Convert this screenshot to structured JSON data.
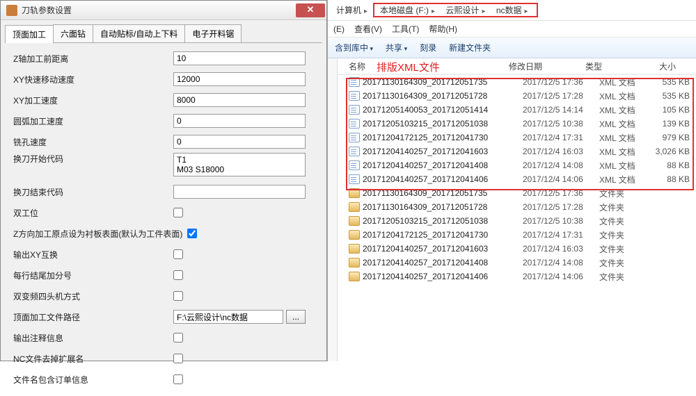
{
  "dialog": {
    "title": "刀轨参数设置",
    "close": "✕",
    "tabs": [
      "顶面加工",
      "六面钻",
      "自动贴标/自动上下料",
      "电子开料锯"
    ],
    "activeTab": 0,
    "fields": {
      "z_before": {
        "label": "Z轴加工前距离",
        "value": "10"
      },
      "xy_rapid": {
        "label": "XY快速移动速度",
        "value": "12000"
      },
      "xy_feed": {
        "label": "XY加工速度",
        "value": "8000"
      },
      "arc_feed": {
        "label": "圆弧加工速度",
        "value": "0"
      },
      "bore_feed": {
        "label": "铣孔速度",
        "value": "0"
      },
      "tool_start": {
        "label": "换刀开始代码",
        "value": "T1\nM03 S18000"
      },
      "tool_end": {
        "label": "换刀结束代码",
        "value": ""
      },
      "dual_station": {
        "label": "双工位",
        "checked": false
      },
      "z_origin_board": {
        "label": "Z方向加工原点设为衬板表面(默认为工件表面)",
        "checked": true
      },
      "out_xy_swap": {
        "label": "输出XY互换",
        "checked": false
      },
      "semi_each": {
        "label": "每行结尾加分号",
        "checked": false
      },
      "dual_freq": {
        "label": "双变频四头机方式",
        "checked": false
      },
      "top_path": {
        "label": "顶面加工文件路径",
        "value": "F:\\云熙设计\\nc数据",
        "browse": "..."
      },
      "out_note": {
        "label": "输出注释信息",
        "checked": false
      },
      "nc_noext": {
        "label": "NC文件去掉扩展名",
        "checked": false
      },
      "fname_order": {
        "label": "文件名包含订单信息",
        "checked": false
      }
    }
  },
  "explorer": {
    "breadcrumb": [
      "计算机",
      "本地磁盘 (F:)",
      "云熙设计",
      "nc数据"
    ],
    "menubar": [
      "(E)",
      "查看(V)",
      "工具(T)",
      "帮助(H)"
    ],
    "toolbar": {
      "include": "含到库中",
      "share": "共享",
      "burn": "刻录",
      "newfolder": "新建文件夹"
    },
    "columns": {
      "name": "名称",
      "date": "修改日期",
      "type": "类型",
      "size": "大小"
    },
    "annotation": "排版XML文件",
    "files": [
      {
        "icon": "xml",
        "name": "20171130164309_201712051735",
        "date": "2017/12/5 17:36",
        "type": "XML 文档",
        "size": "535 KB"
      },
      {
        "icon": "xml",
        "name": "20171130164309_201712051728",
        "date": "2017/12/5 17:28",
        "type": "XML 文档",
        "size": "535 KB"
      },
      {
        "icon": "xml",
        "name": "20171205140053_201712051414",
        "date": "2017/12/5 14:14",
        "type": "XML 文档",
        "size": "105 KB"
      },
      {
        "icon": "xml",
        "name": "20171205103215_201712051038",
        "date": "2017/12/5 10:38",
        "type": "XML 文档",
        "size": "139 KB"
      },
      {
        "icon": "xml",
        "name": "20171204172125_201712041730",
        "date": "2017/12/4 17:31",
        "type": "XML 文档",
        "size": "979 KB"
      },
      {
        "icon": "xml",
        "name": "20171204140257_201712041603",
        "date": "2017/12/4 16:03",
        "type": "XML 文档",
        "size": "3,026 KB"
      },
      {
        "icon": "xml",
        "name": "20171204140257_201712041408",
        "date": "2017/12/4 14:08",
        "type": "XML 文档",
        "size": "88 KB"
      },
      {
        "icon": "xml",
        "name": "20171204140257_201712041406",
        "date": "2017/12/4 14:06",
        "type": "XML 文档",
        "size": "88 KB"
      },
      {
        "icon": "folder",
        "name": "20171130164309_201712051735",
        "date": "2017/12/5 17:36",
        "type": "文件夹",
        "size": ""
      },
      {
        "icon": "folder",
        "name": "20171130164309_201712051728",
        "date": "2017/12/5 17:28",
        "type": "文件夹",
        "size": ""
      },
      {
        "icon": "folder",
        "name": "20171205103215_201712051038",
        "date": "2017/12/5 10:38",
        "type": "文件夹",
        "size": ""
      },
      {
        "icon": "folder",
        "name": "20171204172125_201712041730",
        "date": "2017/12/4 17:31",
        "type": "文件夹",
        "size": ""
      },
      {
        "icon": "folder",
        "name": "20171204140257_201712041603",
        "date": "2017/12/4 16:03",
        "type": "文件夹",
        "size": ""
      },
      {
        "icon": "folder",
        "name": "20171204140257_201712041408",
        "date": "2017/12/4 14:08",
        "type": "文件夹",
        "size": ""
      },
      {
        "icon": "folder",
        "name": "20171204140257_201712041406",
        "date": "2017/12/4 14:06",
        "type": "文件夹",
        "size": ""
      }
    ]
  }
}
